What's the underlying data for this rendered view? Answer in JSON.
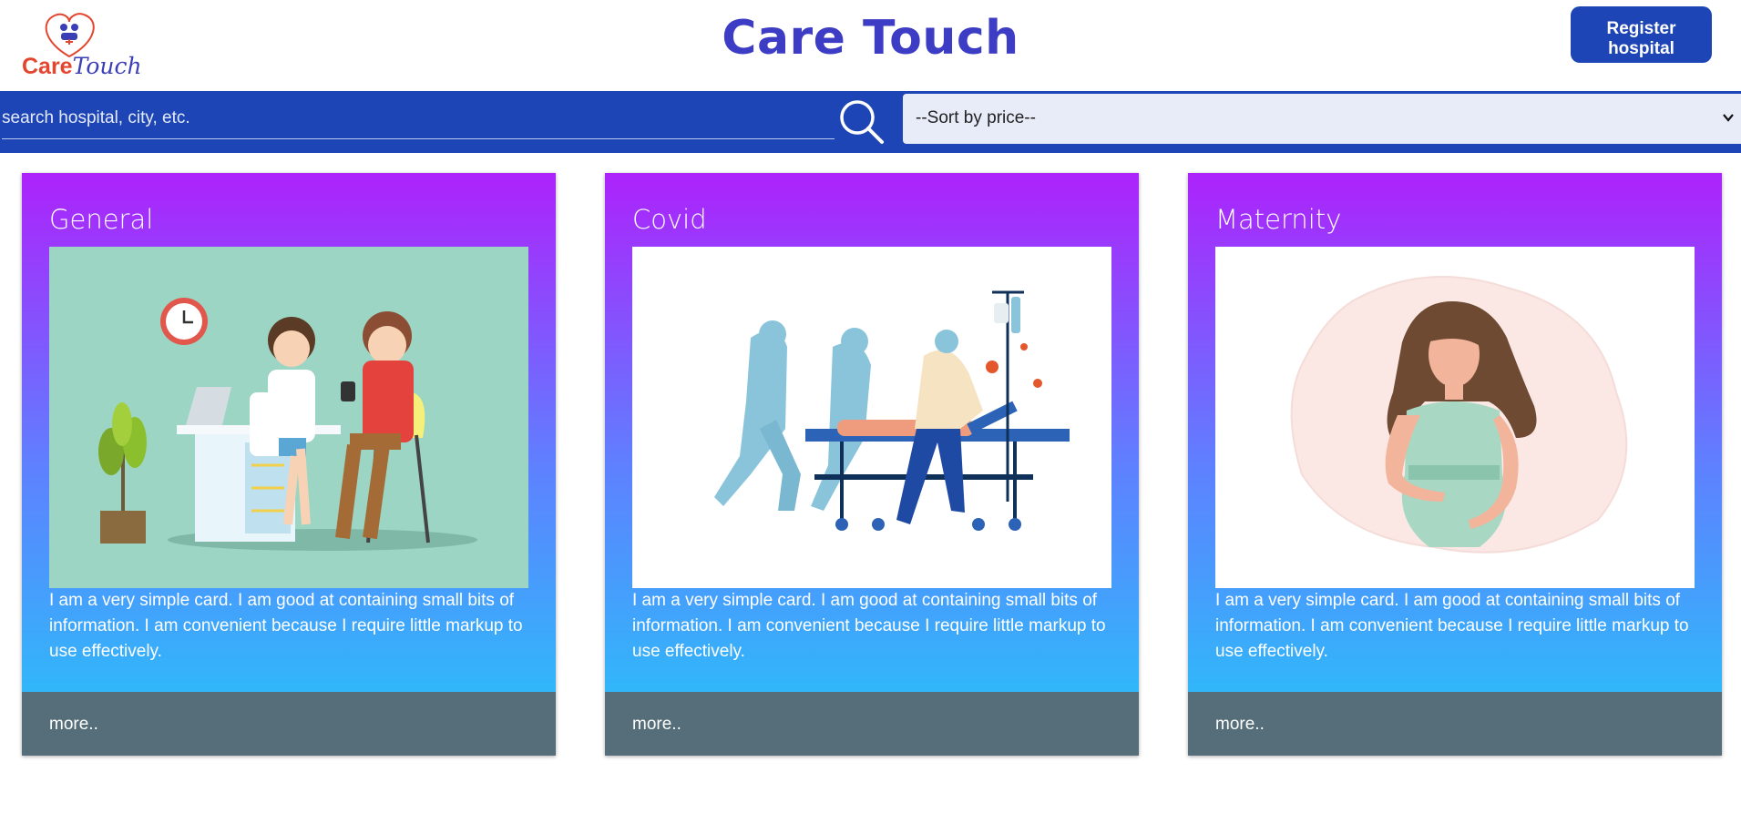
{
  "header": {
    "logo_care": "Care",
    "logo_touch": "Touch",
    "title": "Care Touch",
    "register_label": "Register hospital"
  },
  "toolbar": {
    "search_placeholder": "search hospital, city, etc.",
    "sort_selected": "--Sort by price--"
  },
  "cards": [
    {
      "title": "General",
      "text": "I am a very simple card. I am good at containing small bits of information. I am convenient because I require little markup to use effectively.",
      "link": "more.."
    },
    {
      "title": "Covid",
      "text": "I am a very simple card. I am good at containing small bits of information. I am convenient because I require little markup to use effectively.",
      "link": "more.."
    },
    {
      "title": "Maternity",
      "text": "I am a very simple card. I am good at containing small bits of information. I am convenient because I require little markup to use effectively.",
      "link": "more.."
    }
  ],
  "colors": {
    "primary": "#1d45b5",
    "title": "#3c3cc4",
    "gradient_top": "#ad22fb",
    "gradient_bottom": "#24c6f8",
    "card_footer": "#566e7a"
  },
  "icons": {
    "search": "search-icon",
    "sort": "chevron-down-icon"
  }
}
